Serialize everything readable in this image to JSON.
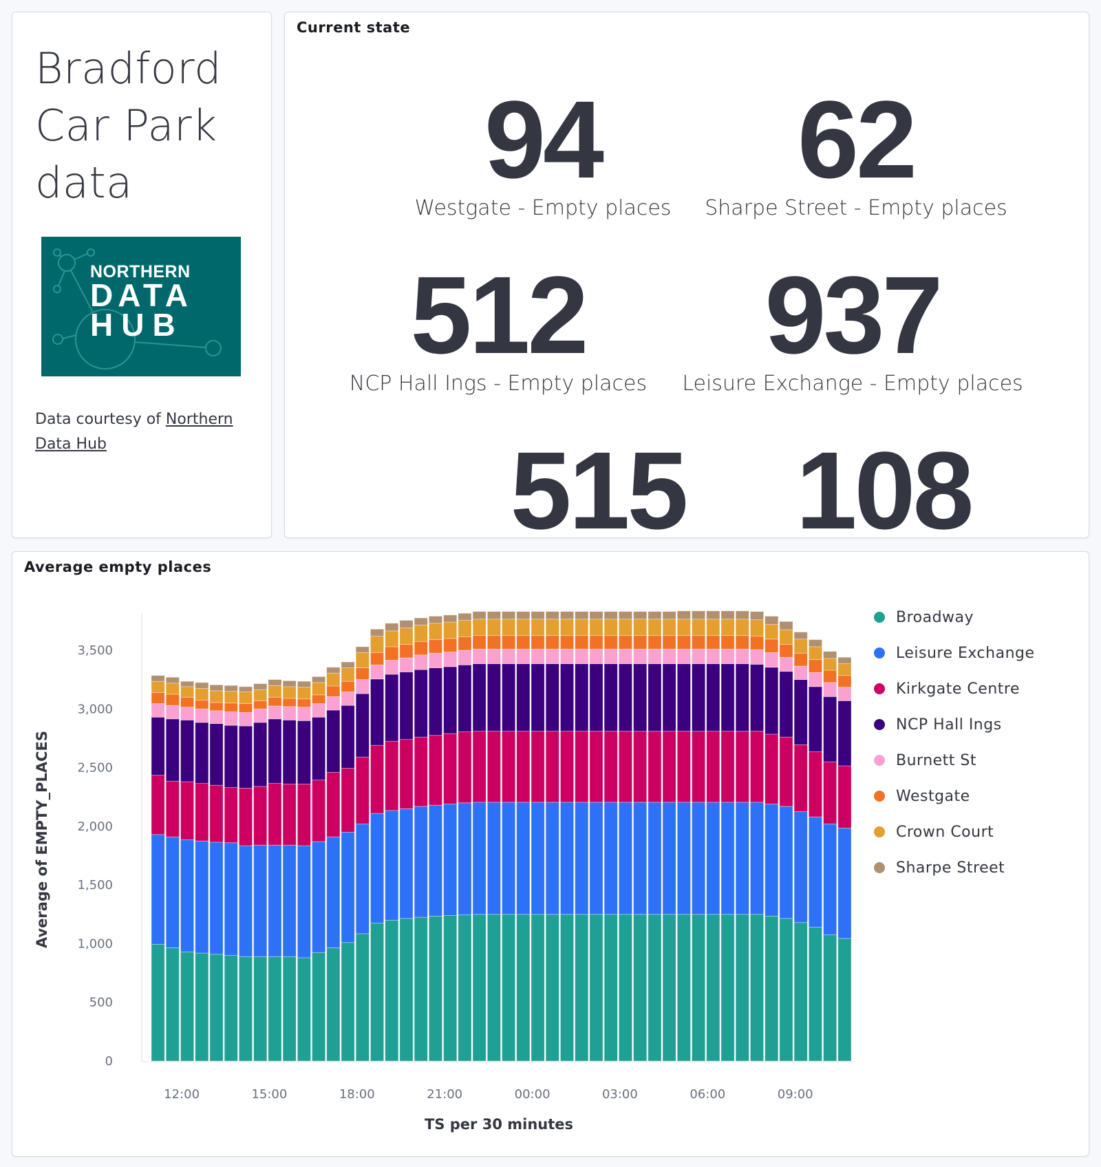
{
  "intro": {
    "title_lines": [
      "Bradford",
      "Car Park",
      "data"
    ],
    "logo": {
      "line1": "NORTHERN",
      "line2": "DATA",
      "line3": "HUB",
      "bg_color": "#00686b"
    },
    "courtesy_prefix": "Data courtesy of ",
    "courtesy_link": "Northern Data Hub"
  },
  "current_state": {
    "title": "Current state",
    "metrics": [
      {
        "value": "94",
        "label": "Westgate - Empty places"
      },
      {
        "value": "62",
        "label": "Sharpe Street - Empty places"
      },
      {
        "value": "512",
        "label": "NCP Hall Ings - Empty places"
      },
      {
        "value": "937",
        "label": "Leisure Exchange - Empty places"
      },
      {
        "value": "515",
        "label": ""
      },
      {
        "value": "108",
        "label": ""
      }
    ]
  },
  "chart_panel": {
    "title": "Average empty places"
  },
  "chart_data": {
    "type": "bar",
    "stacked": true,
    "title": "Average empty places",
    "xlabel": "TS per 30 minutes",
    "ylabel": "Average of EMPTY_PLACES",
    "ylim": [
      0,
      3800
    ],
    "yticks": [
      0,
      500,
      1000,
      1500,
      2000,
      2500,
      3000,
      3500
    ],
    "ytick_labels": [
      "0",
      "500",
      "1,000",
      "1,500",
      "2,000",
      "2,500",
      "3,000",
      "3,500"
    ],
    "xtick_labels": [
      "12:00",
      "15:00",
      "18:00",
      "21:00",
      "00:00",
      "03:00",
      "06:00",
      "09:00"
    ],
    "xtick_indices": [
      2,
      8,
      14,
      20,
      26,
      32,
      38,
      44
    ],
    "grid": false,
    "legend_position": "right",
    "categories": [
      "11:00",
      "11:30",
      "12:00",
      "12:30",
      "13:00",
      "13:30",
      "14:00",
      "14:30",
      "15:00",
      "15:30",
      "16:00",
      "16:30",
      "17:00",
      "17:30",
      "18:00",
      "18:30",
      "19:00",
      "19:30",
      "20:00",
      "20:30",
      "21:00",
      "21:30",
      "22:00",
      "22:30",
      "23:00",
      "23:30",
      "00:00",
      "00:30",
      "01:00",
      "01:30",
      "02:00",
      "02:30",
      "03:00",
      "03:30",
      "04:00",
      "04:30",
      "05:00",
      "05:30",
      "06:00",
      "06:30",
      "07:00",
      "07:30",
      "08:00",
      "08:30",
      "09:00",
      "09:30",
      "10:00",
      "10:30"
    ],
    "series": [
      {
        "name": "Broadway",
        "color": "#209f94",
        "values": [
          995,
          965,
          930,
          920,
          910,
          900,
          890,
          890,
          890,
          890,
          880,
          925,
          965,
          1010,
          1085,
          1175,
          1200,
          1215,
          1225,
          1235,
          1240,
          1245,
          1250,
          1250,
          1250,
          1250,
          1250,
          1250,
          1250,
          1250,
          1250,
          1250,
          1250,
          1250,
          1250,
          1250,
          1250,
          1250,
          1250,
          1250,
          1250,
          1250,
          1235,
          1215,
          1180,
          1140,
          1075,
          1045
        ]
      },
      {
        "name": "Leisure Exchange",
        "color": "#2d71f6",
        "values": [
          935,
          945,
          955,
          955,
          955,
          960,
          945,
          950,
          950,
          950,
          955,
          945,
          945,
          940,
          935,
          935,
          935,
          935,
          945,
          945,
          950,
          955,
          955,
          955,
          955,
          955,
          955,
          955,
          955,
          955,
          955,
          955,
          955,
          955,
          955,
          955,
          955,
          955,
          955,
          955,
          955,
          955,
          955,
          955,
          945,
          940,
          945,
          940
        ]
      },
      {
        "name": "Kirkgate Centre",
        "color": "#cc0060",
        "values": [
          505,
          475,
          495,
          490,
          485,
          470,
          490,
          500,
          525,
          520,
          525,
          525,
          550,
          545,
          570,
          580,
          590,
          590,
          590,
          595,
          600,
          605,
          605,
          605,
          605,
          605,
          605,
          605,
          605,
          605,
          605,
          605,
          605,
          605,
          605,
          605,
          605,
          605,
          605,
          605,
          605,
          605,
          595,
          590,
          570,
          555,
          530,
          530
        ]
      },
      {
        "name": "NCP Hall Ings",
        "color": "#3a007d",
        "values": [
          495,
          530,
          525,
          520,
          525,
          530,
          530,
          545,
          550,
          545,
          540,
          535,
          530,
          535,
          540,
          565,
          570,
          575,
          575,
          575,
          570,
          570,
          575,
          575,
          575,
          575,
          575,
          575,
          575,
          575,
          575,
          575,
          575,
          575,
          575,
          575,
          575,
          575,
          575,
          575,
          575,
          570,
          570,
          560,
          555,
          555,
          555,
          555
        ]
      },
      {
        "name": "Burnett St",
        "color": "#fba1d1",
        "values": [
          115,
          115,
          110,
          115,
          110,
          115,
          115,
          115,
          110,
          115,
          115,
          115,
          115,
          115,
          120,
          120,
          120,
          120,
          125,
          125,
          125,
          125,
          125,
          125,
          125,
          125,
          125,
          125,
          125,
          125,
          125,
          125,
          125,
          125,
          125,
          125,
          125,
          125,
          125,
          125,
          125,
          125,
          125,
          120,
          115,
          120,
          120,
          115
        ]
      },
      {
        "name": "Westgate",
        "color": "#f27124",
        "values": [
          95,
          95,
          85,
          75,
          70,
          75,
          75,
          70,
          75,
          70,
          70,
          75,
          90,
          90,
          100,
          105,
          115,
          115,
          115,
          115,
          115,
          115,
          115,
          115,
          115,
          115,
          115,
          115,
          115,
          115,
          115,
          115,
          115,
          115,
          115,
          115,
          115,
          115,
          115,
          115,
          115,
          115,
          115,
          110,
          110,
          110,
          105,
          100
        ]
      },
      {
        "name": "Crown Court",
        "color": "#e49f2e",
        "values": [
          95,
          95,
          90,
          100,
          100,
          100,
          100,
          95,
          100,
          100,
          100,
          105,
          110,
          115,
          130,
          140,
          135,
          140,
          140,
          140,
          140,
          140,
          140,
          140,
          140,
          140,
          140,
          140,
          140,
          140,
          140,
          140,
          140,
          140,
          140,
          140,
          140,
          140,
          140,
          140,
          140,
          140,
          125,
          125,
          120,
          110,
          100,
          100
        ]
      },
      {
        "name": "Sharpe Street",
        "color": "#b19071",
        "values": [
          50,
          50,
          45,
          50,
          50,
          50,
          45,
          50,
          50,
          50,
          50,
          50,
          50,
          50,
          50,
          60,
          65,
          65,
          60,
          60,
          60,
          60,
          65,
          65,
          65,
          65,
          65,
          65,
          65,
          65,
          65,
          65,
          65,
          65,
          65,
          65,
          70,
          70,
          70,
          70,
          70,
          70,
          70,
          70,
          60,
          60,
          60,
          55
        ]
      }
    ]
  }
}
